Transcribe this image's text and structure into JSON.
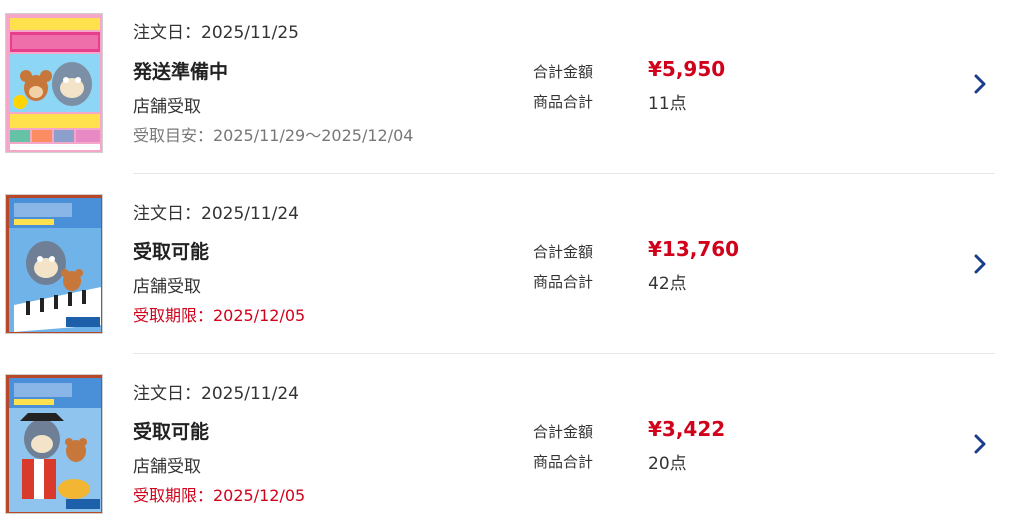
{
  "orders": [
    {
      "date": "注文日：2025/11/25",
      "status": "発送準備中",
      "pickup_method": "店舗受取",
      "pickup_note": "受取目安：2025/11/29～2025/12/04",
      "total_label": "合計金額",
      "total": "¥5,950",
      "count_label": "商品合計",
      "count": "11点",
      "thumbnail_icon": "tom-and-jerry-dvd-cover-icon"
    },
    {
      "date": "注文日：2025/11/24",
      "status": "受取可能",
      "pickup_method": "店舗受取",
      "pickup_note": "受取期限：2025/12/05",
      "total_label": "合計金額",
      "total": "¥13,760",
      "count_label": "商品合計",
      "count": "42点",
      "thumbnail_icon": "tom-and-jerry-dvd-cover-icon"
    },
    {
      "date": "注文日：2025/11/24",
      "status": "受取可能",
      "pickup_method": "店舗受取",
      "pickup_note": "受取期限：2025/12/05",
      "total_label": "合計金額",
      "total": "¥3,422",
      "count_label": "商品合計",
      "count": "20点",
      "thumbnail_icon": "tom-and-jerry-dvd-cover-icon"
    }
  ],
  "colors": {
    "price": "#d0021b",
    "deadline": "#d0021b",
    "note_gray": "#777777",
    "chevron": "#1a3e8c",
    "divider": "#e6e6e6"
  }
}
